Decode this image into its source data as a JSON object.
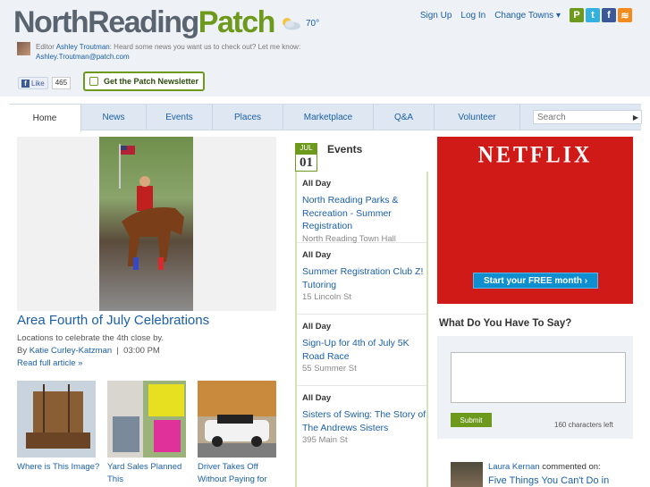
{
  "header": {
    "logo_part1": "NorthReading",
    "logo_part2": "Patch",
    "temperature": "70°",
    "links": {
      "signup": "Sign Up",
      "login": "Log In",
      "change_towns": "Change Towns"
    },
    "editor_prefix": "Editor",
    "editor_name": "Ashley Troutman",
    "editor_message": ": Heard some news you want us to check out? Let me know:",
    "editor_email": "Ashley.Troutman@patch.com",
    "like_label": "Like",
    "like_count": "465",
    "newsletter_label": "Get the Patch Newsletter"
  },
  "nav": {
    "tabs": [
      {
        "label": "Home"
      },
      {
        "label": "News"
      },
      {
        "label": "Events"
      },
      {
        "label": "Places"
      },
      {
        "label": "Marketplace"
      },
      {
        "label": "Q&A"
      },
      {
        "label": "Volunteer"
      }
    ],
    "search_placeholder": "Search"
  },
  "feature": {
    "headline": "Area Fourth of July Celebrations",
    "summary": "Locations to celebrate the 4th close by.",
    "by_prefix": "By",
    "author": "Katie Curley-Katzman",
    "separator": "|",
    "time": "03:00 PM",
    "read_more": "Read full article »"
  },
  "thumbs": [
    {
      "caption": "Where is This Image?"
    },
    {
      "caption": "Yard Sales Planned This"
    },
    {
      "caption": "Driver Takes Off Without Paying for"
    }
  ],
  "events": {
    "month": "JUL",
    "day": "01",
    "title": "Events",
    "items": [
      {
        "time": "All Day",
        "name": "North Reading Parks & Recreation - Summer Registration",
        "place": "North Reading Town Hall"
      },
      {
        "time": "All Day",
        "name": "Summer Registration Club Z! Tutoring",
        "place": "15 Lincoln St"
      },
      {
        "time": "All Day",
        "name": "Sign-Up for 4th of July 5K Road Race",
        "place": "55 Summer St"
      },
      {
        "time": "All Day",
        "name": "Sisters of Swing: The Story of The Andrews Sisters",
        "place": "395 Main St"
      }
    ]
  },
  "ad": {
    "brand": "NETFLIX",
    "cta": "Start your FREE month ›",
    "bg_color": "#d01a18"
  },
  "say": {
    "heading": "What Do You Have To Say?",
    "submit": "Submit",
    "chars_left": "160 characters left"
  },
  "comment": {
    "user": "Laura Kernan",
    "action": "commented on:",
    "article": "Five Things You Can't Do in"
  },
  "colors": {
    "accent": "#6d9a1c",
    "link": "#1a5fa8",
    "nav_bg": "#dfe8f2"
  }
}
